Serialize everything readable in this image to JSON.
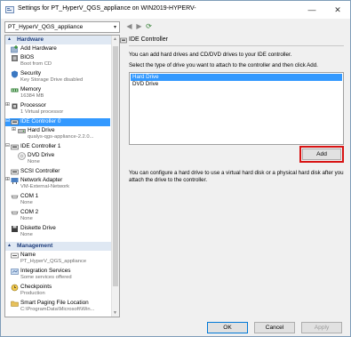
{
  "window": {
    "title": "Settings for PT_HyperV_QGS_appliance on WIN2019-HYPERV-",
    "min_glyph": "—",
    "close_glyph": "✕"
  },
  "vm_selector": {
    "value": "PT_HyperV_QGS_appliance",
    "arrow": "▾"
  },
  "nav": {
    "back": "◀",
    "forward": "▶",
    "refresh": "⟳"
  },
  "tree": {
    "hardware_header": "Hardware",
    "management_header": "Management",
    "items": [
      {
        "label": "Add Hardware",
        "sub": ""
      },
      {
        "label": "BIOS",
        "sub": "Boot from CD"
      },
      {
        "label": "Security",
        "sub": "Key Storage Drive disabled"
      },
      {
        "label": "Memory",
        "sub": "16384 MB"
      },
      {
        "label": "Processor",
        "sub": "1 Virtual processor"
      },
      {
        "label": "IDE Controller 0",
        "sub": ""
      },
      {
        "label": "Hard Drive",
        "sub": "qualys-qgs-appliance-2.2.0..."
      },
      {
        "label": "IDE Controller 1",
        "sub": ""
      },
      {
        "label": "DVD Drive",
        "sub": "None"
      },
      {
        "label": "SCSI Controller",
        "sub": ""
      },
      {
        "label": "Network Adapter",
        "sub": "VM-External-Network"
      },
      {
        "label": "COM 1",
        "sub": "None"
      },
      {
        "label": "COM 2",
        "sub": "None"
      },
      {
        "label": "Diskette Drive",
        "sub": "None"
      },
      {
        "label": "Name",
        "sub": "PT_HyperV_QGS_appliance"
      },
      {
        "label": "Integration Services",
        "sub": "Some services offered"
      },
      {
        "label": "Checkpoints",
        "sub": "Production"
      },
      {
        "label": "Smart Paging File Location",
        "sub": "C:\\ProgramData\\Microsoft\\Win..."
      }
    ]
  },
  "panel": {
    "title": "IDE Controller",
    "desc1": "You can add hard drives and CD/DVD drives to your IDE controller.",
    "desc2": "Select the type of drive you want to attach to the controller and then click Add.",
    "options": [
      "Hard Drive",
      "DVD Drive"
    ],
    "selected_option": "Hard Drive",
    "add_label": "Add",
    "desc3": "You can configure a hard drive to use a virtual hard disk or a physical hard disk after you attach the drive to the controller."
  },
  "buttons": {
    "ok": "OK",
    "cancel": "Cancel",
    "apply": "Apply"
  },
  "colors": {
    "selection": "#3399ff",
    "highlight": "#d81414",
    "header_bg": "#dfe8f3"
  }
}
